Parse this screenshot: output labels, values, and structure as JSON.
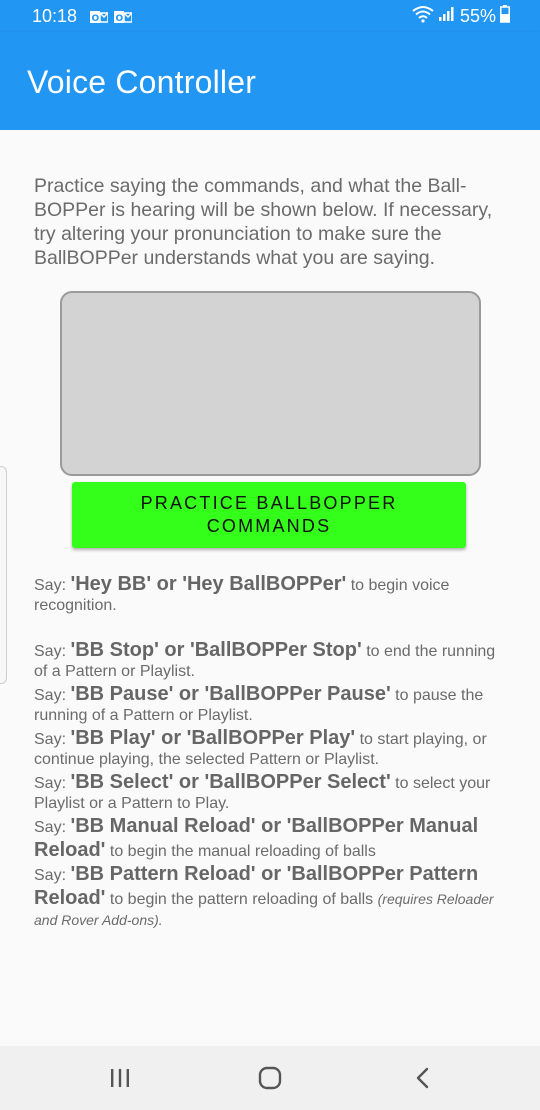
{
  "status_bar": {
    "time": "10:18",
    "battery_text": "55%",
    "notification_icons": [
      "outlook-icon",
      "outlook-icon"
    ],
    "system_icons": [
      "wifi-icon",
      "signal-icon",
      "battery-icon"
    ]
  },
  "app_bar": {
    "title": "Voice Controller",
    "color": "#2196f3"
  },
  "intro_text": "Practice saying the commands, and what the Ball-BOPPer is hearing will be shown below. If necessary, try altering your pronunciation to make sure the BallBOPPer understands what you are saying.",
  "practice_button": {
    "label": "PRACTICE BALLBOPPER COMMANDS",
    "color": "#33ff1a"
  },
  "commands": [
    {
      "say": "Say: ",
      "phrase": "'Hey BB' or 'Hey BallBOPPer'",
      "desc": " to begin voice recognition.",
      "note": ""
    },
    {
      "say": "Say: ",
      "phrase": "'BB Stop' or 'BallBOPPer Stop'",
      "desc": " to end the running of a Pattern or Playlist.",
      "note": ""
    },
    {
      "say": "Say: ",
      "phrase": "'BB Pause' or 'BallBOPPer Pause'",
      "desc": " to pause the running of a Pattern or Playlist.",
      "note": ""
    },
    {
      "say": "Say: ",
      "phrase": "'BB Play' or 'BallBOPPer Play'",
      "desc": " to start playing, or continue playing, the selected Pattern or Playlist.",
      "note": ""
    },
    {
      "say": "Say: ",
      "phrase": "'BB Select' or 'BallBOPPer Select'",
      "desc": " to select your Playlist or a Pattern to Play.",
      "note": ""
    },
    {
      "say": "Say: ",
      "phrase": "'BB Manual Reload' or 'BallBOPPer Manual Reload'",
      "desc": " to begin the manual reloading of balls",
      "note": ""
    },
    {
      "say": "Say: ",
      "phrase": "'BB Pattern Reload' or 'BallBOPPer Pattern Reload'",
      "desc": " to begin the pattern reloading of balls ",
      "note": "(requires Reloader and Rover Add-ons)."
    }
  ],
  "nav_bar": {
    "buttons": [
      "recents-icon",
      "home-icon",
      "back-icon"
    ]
  }
}
